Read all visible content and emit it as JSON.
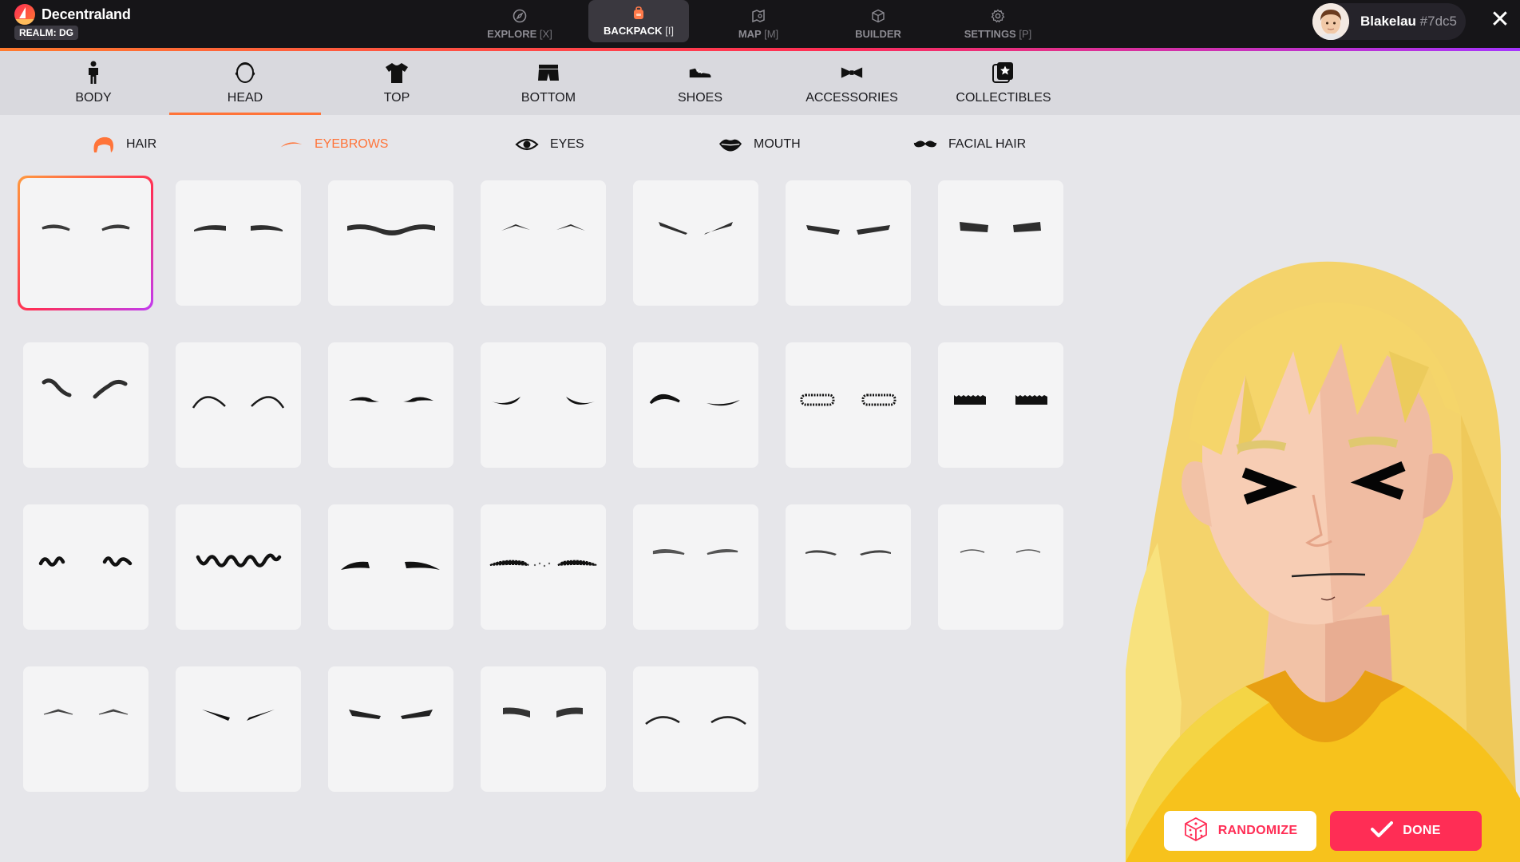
{
  "app": {
    "name": "Decentraland",
    "realm": "REALM: DG"
  },
  "topnav": [
    {
      "label": "EXPLORE",
      "key": "[X]",
      "active": false
    },
    {
      "label": "BACKPACK",
      "key": "[I]",
      "active": true
    },
    {
      "label": "MAP",
      "key": "[M]",
      "active": false
    },
    {
      "label": "BUILDER",
      "key": "",
      "active": false
    },
    {
      "label": "SETTINGS",
      "key": "[P]",
      "active": false
    }
  ],
  "user": {
    "name": "Blakelau",
    "tag": "#7dc5"
  },
  "categories": [
    {
      "label": "BODY",
      "icon": "body-icon"
    },
    {
      "label": "HEAD",
      "icon": "head-icon",
      "active": true
    },
    {
      "label": "TOP",
      "icon": "shirt-icon"
    },
    {
      "label": "BOTTOM",
      "icon": "shorts-icon"
    },
    {
      "label": "SHOES",
      "icon": "shoe-icon"
    },
    {
      "label": "ACCESSORIES",
      "icon": "bowtie-icon"
    },
    {
      "label": "COLLECTIBLES",
      "icon": "star-cards-icon"
    }
  ],
  "subcategories": [
    {
      "label": "HAIR",
      "icon": "hair-icon"
    },
    {
      "label": "EYEBROWS",
      "icon": "eyebrow-icon",
      "active": true
    },
    {
      "label": "EYES",
      "icon": "eye-icon"
    },
    {
      "label": "MOUTH",
      "icon": "lips-icon"
    },
    {
      "label": "FACIAL HAIR",
      "icon": "mustache-icon"
    }
  ],
  "grid": {
    "columns": 7,
    "item_count": 26,
    "selected_index": 0
  },
  "actions": {
    "randomize": "RANDOMIZE",
    "done": "DONE"
  },
  "colors": {
    "accent": "#ff7439",
    "primary": "#ff2d55",
    "topbar": "#161518"
  }
}
